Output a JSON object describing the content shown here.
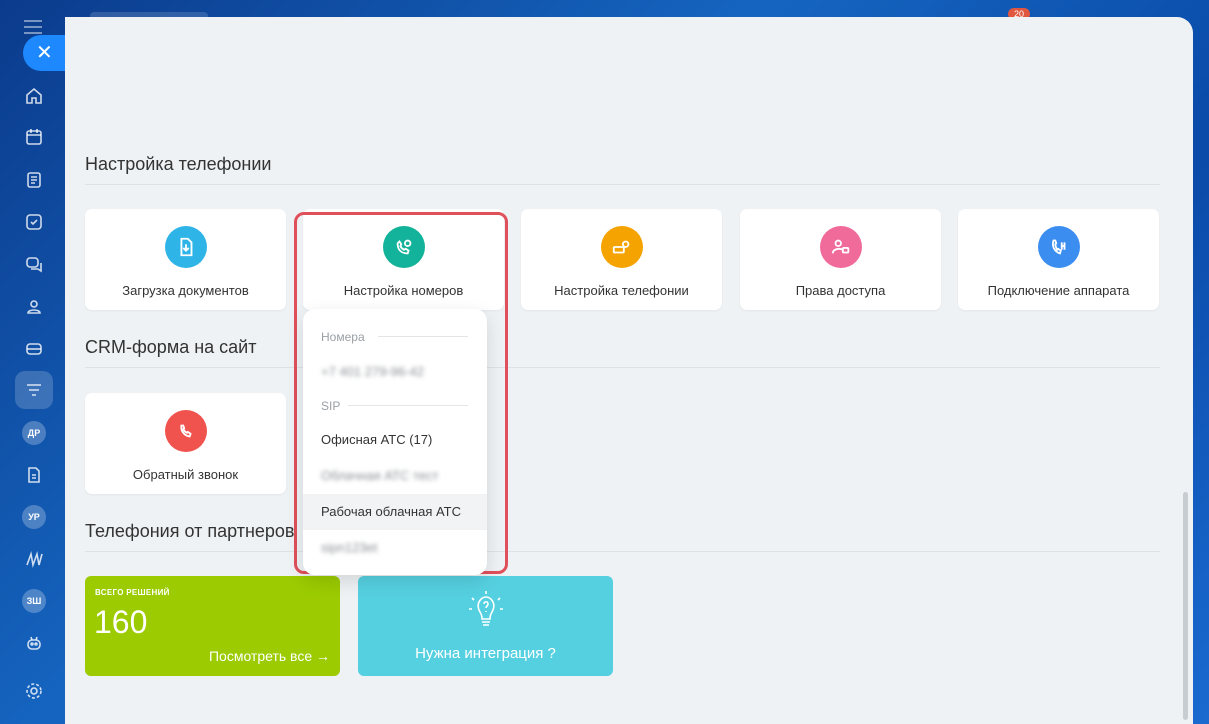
{
  "top": {
    "notification_count": "20"
  },
  "rail": {
    "close_symbol": "✕",
    "items": [
      {
        "icon": "home-icon"
      },
      {
        "icon": "calendar-icon"
      },
      {
        "icon": "document-icon"
      },
      {
        "icon": "task-icon"
      },
      {
        "icon": "chat-icon"
      },
      {
        "icon": "contacts-icon"
      },
      {
        "icon": "crm-icon"
      },
      {
        "icon": "funnel-icon"
      },
      {
        "badge": "ДР"
      },
      {
        "icon": "file-icon"
      },
      {
        "badge": "УР"
      },
      {
        "icon": "sites-icon"
      },
      {
        "badge": "ЗШ"
      },
      {
        "icon": "robot-icon"
      },
      {
        "icon": "settings-icon"
      }
    ]
  },
  "sections": {
    "telephony_settings": "Настройка телефонии",
    "crm_form": "CRM-форма на сайт",
    "partners": "Телефония от партнеров"
  },
  "cards": [
    {
      "label": "Загрузка документов",
      "color": "#2fb4e8",
      "icon": "download-doc-icon"
    },
    {
      "label": "Настройка номеров",
      "color": "#13b29a",
      "icon": "phone-gear-icon"
    },
    {
      "label": "Настройка телефонии",
      "color": "#f4a300",
      "icon": "pbx-gear-icon"
    },
    {
      "label": "Права доступа",
      "color": "#f06a9a",
      "icon": "user-lock-icon"
    },
    {
      "label": "Подключение аппарата",
      "color": "#3b8ef0",
      "icon": "phone-plug-icon"
    }
  ],
  "crm_card": {
    "label": "Обратный звонок",
    "color": "#f0524e",
    "icon": "callback-icon"
  },
  "dropdown": {
    "numbers_header": "Номера",
    "number": "+7 401 279-96-42",
    "sip_header": "SIP",
    "sip_items": [
      "Офисная АТС (17)",
      "Облачная АТС тест",
      "Рабочая облачная АТС",
      "sipn123et"
    ]
  },
  "partners": {
    "total_caption": "ВСЕГО РЕШЕНИЙ",
    "total": "160",
    "view_all": "Посмотреть все",
    "arrow": "→",
    "need_integration": "Нужна интеграция ?"
  }
}
